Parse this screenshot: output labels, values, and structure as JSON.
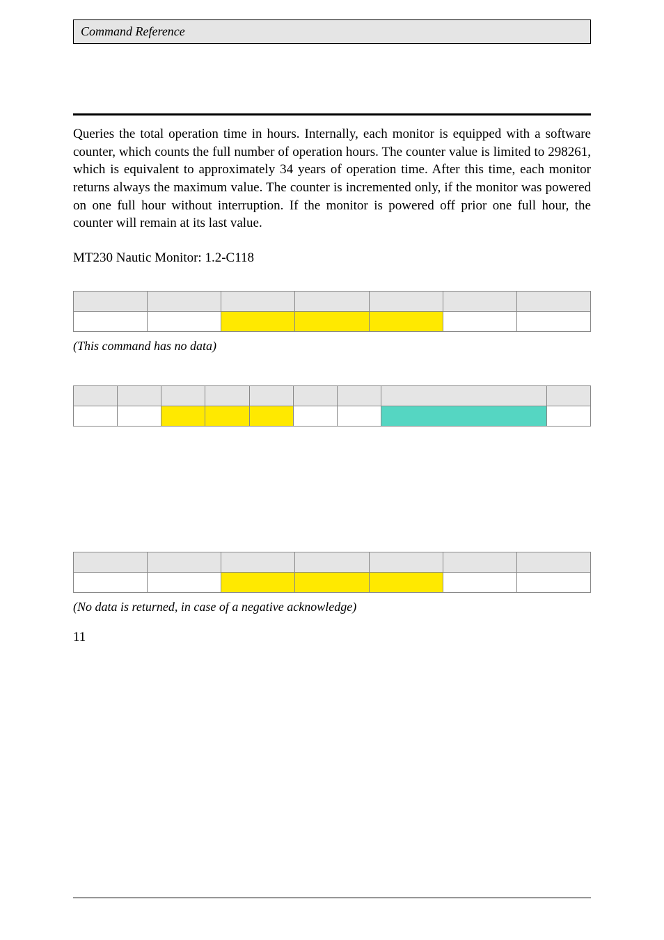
{
  "header": {
    "title": "Command Reference"
  },
  "section": {
    "description": "Queries the total operation time in hours. Internally, each monitor is equipped with a software counter, which counts the full number of operation hours. The counter value is limited to 298261, which is equivalent to approximately 34 years of operation time. After this time, each monitor returns always the maximum value. The counter is incremented only, if the monitor was powered on one full hour without interruption. If the monitor is powered off prior one full hour, the counter will remain at its last value.",
    "firmware_line": "MT230 Nautic Monitor: 1.2-C118"
  },
  "tables": {
    "t1": {
      "caption": "(This command has no data)",
      "headers": [
        "",
        "",
        "",
        "",
        "",
        "",
        ""
      ],
      "cells": [
        "",
        "",
        "",
        "",
        "",
        "",
        ""
      ]
    },
    "t2": {
      "headers": [
        "",
        "",
        "",
        "",
        "",
        "",
        "",
        "",
        ""
      ],
      "cells": [
        "",
        "",
        "",
        "",
        "",
        "",
        "",
        "",
        ""
      ]
    },
    "t3": {
      "caption": "(No data is returned, in case of a negative acknowledge)",
      "headers": [
        "",
        "",
        "",
        "",
        "",
        "",
        ""
      ],
      "cells": [
        "",
        "",
        "",
        "",
        "",
        "",
        ""
      ]
    }
  },
  "page_number": "11"
}
